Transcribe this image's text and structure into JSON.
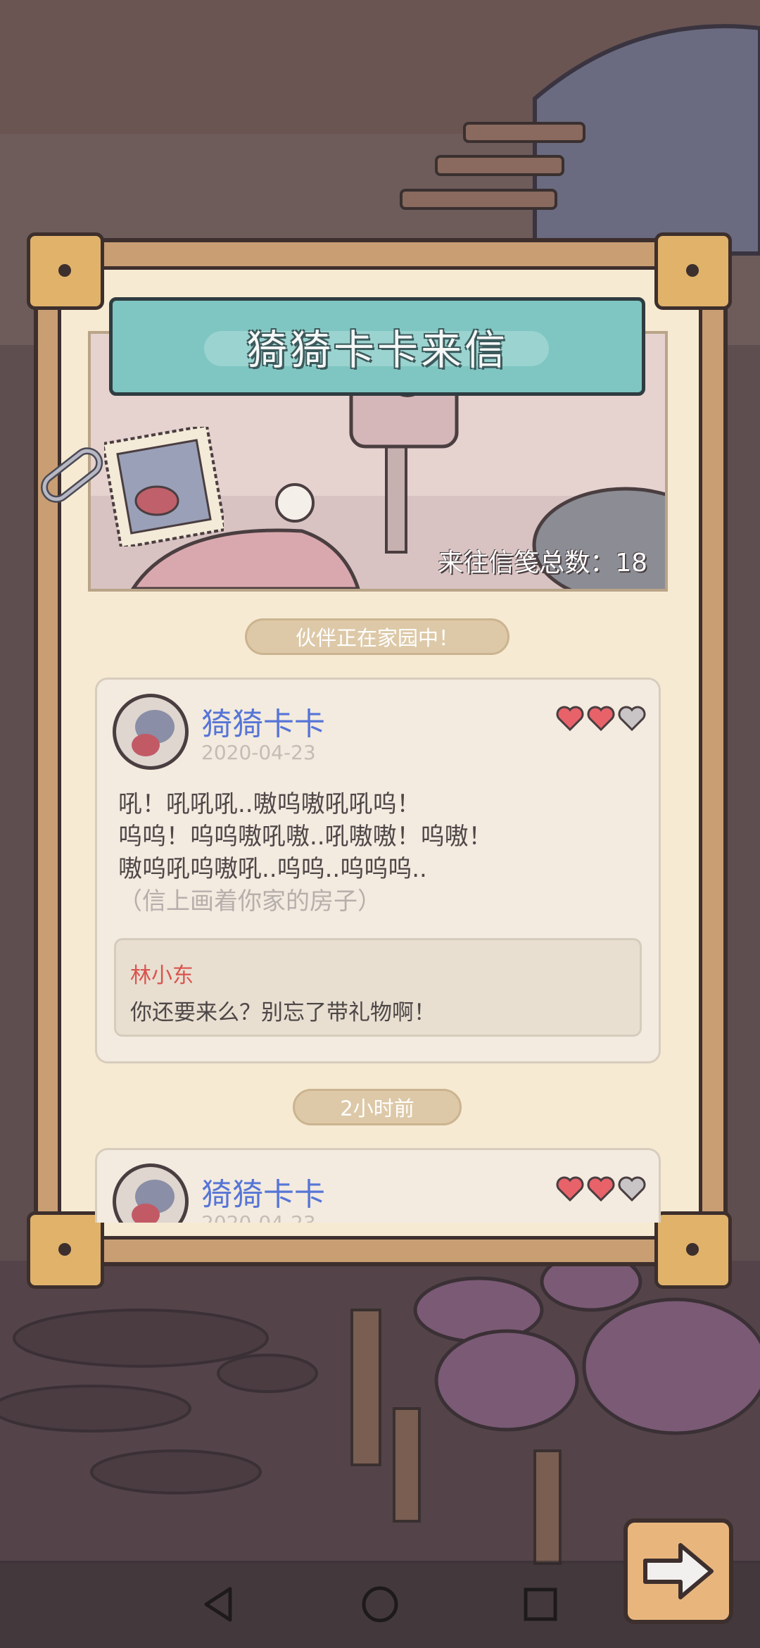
{
  "letter": {
    "title": "猗猗卡卡来信",
    "total_label": "来往信笺总数：18",
    "status": "伙伴正在家园中！"
  },
  "letters": [
    {
      "sender": "猗猗卡卡",
      "date": "2020-04-23",
      "hearts_filled": 2,
      "hearts_total": 3,
      "lines": [
        "吼！吼吼吼..嗷呜嗷吼吼呜！",
        "呜呜！呜呜嗷吼嗷..吼嗷嗷！呜嗷！",
        "嗷呜吼呜嗷吼..呜呜..呜呜呜.."
      ],
      "note": "（信上画着你家的房子）",
      "reply": {
        "name": "林小东",
        "text": "你还要来么？别忘了带礼物啊！"
      }
    },
    {
      "sender": "猗猗卡卡",
      "date": "2020-04-23",
      "hearts_filled": 2,
      "hearts_total": 3
    }
  ],
  "time_separator": "2小时前",
  "colors": {
    "heart_filled": "#e8626a",
    "heart_empty": "#c9c4c6",
    "sender_name": "#5675d6",
    "title_banner": "#7fc6c2"
  },
  "icons": {
    "next": "arrow-right-icon",
    "back": "nav-back-icon",
    "home": "nav-home-icon",
    "recents": "nav-recents-icon"
  }
}
